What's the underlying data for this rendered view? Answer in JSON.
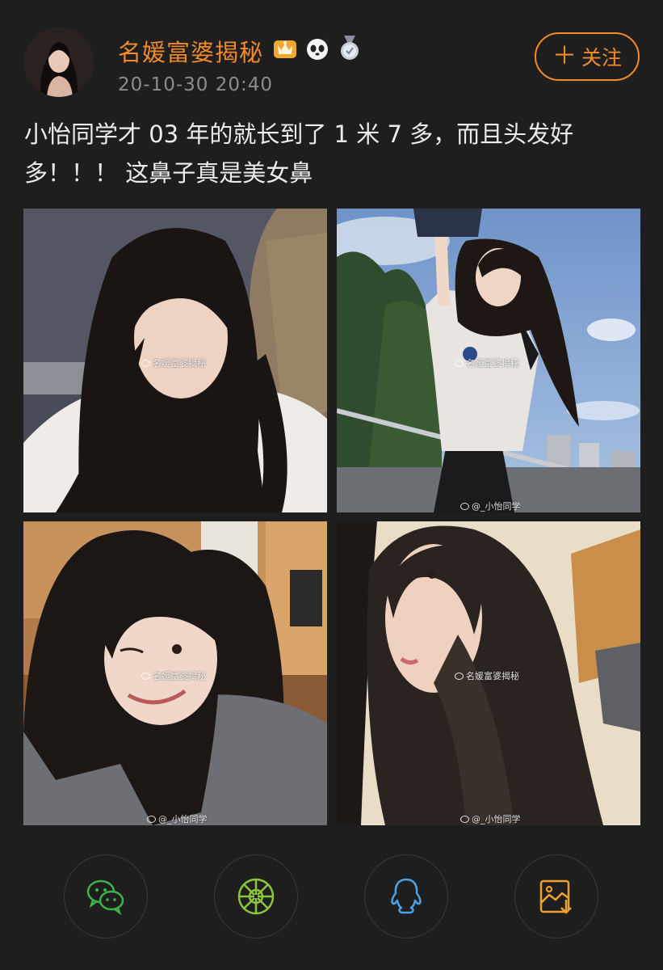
{
  "post": {
    "username": "名媛富婆揭秘",
    "timestamp": "20-10-30 20:40",
    "follow_label": "关注",
    "text_line1": "小怡同学才 03 年的就长到了 1 米 7 多，而且头发好",
    "text_line2": "多！！！ 这鼻子真是美女鼻",
    "badges": [
      "crown-badge-icon",
      "panda-badge-icon",
      "medal-badge-icon"
    ]
  },
  "photos": [
    {
      "watermark": "名媛富婆揭秘"
    },
    {
      "watermark_top": "名媛富婆揭秘",
      "watermark": "@_小怡同学"
    },
    {
      "watermark_top": "名媛富婆揭秘",
      "watermark": "@_小怡同学"
    },
    {
      "watermark_top": "名媛富婆揭秘",
      "watermark": "@_小怡同学"
    }
  ],
  "share": [
    {
      "icon": "wechat-icon",
      "color": "#3cb34a"
    },
    {
      "icon": "moments-icon",
      "color": "#8cc63e"
    },
    {
      "icon": "qq-icon",
      "color": "#4aa3e8"
    },
    {
      "icon": "save-image-icon",
      "color": "#f0a030"
    }
  ],
  "colors": {
    "background": "#1e1e1e",
    "accent": "#f08a2c",
    "text": "#ececec",
    "muted": "#8c8c8c"
  }
}
